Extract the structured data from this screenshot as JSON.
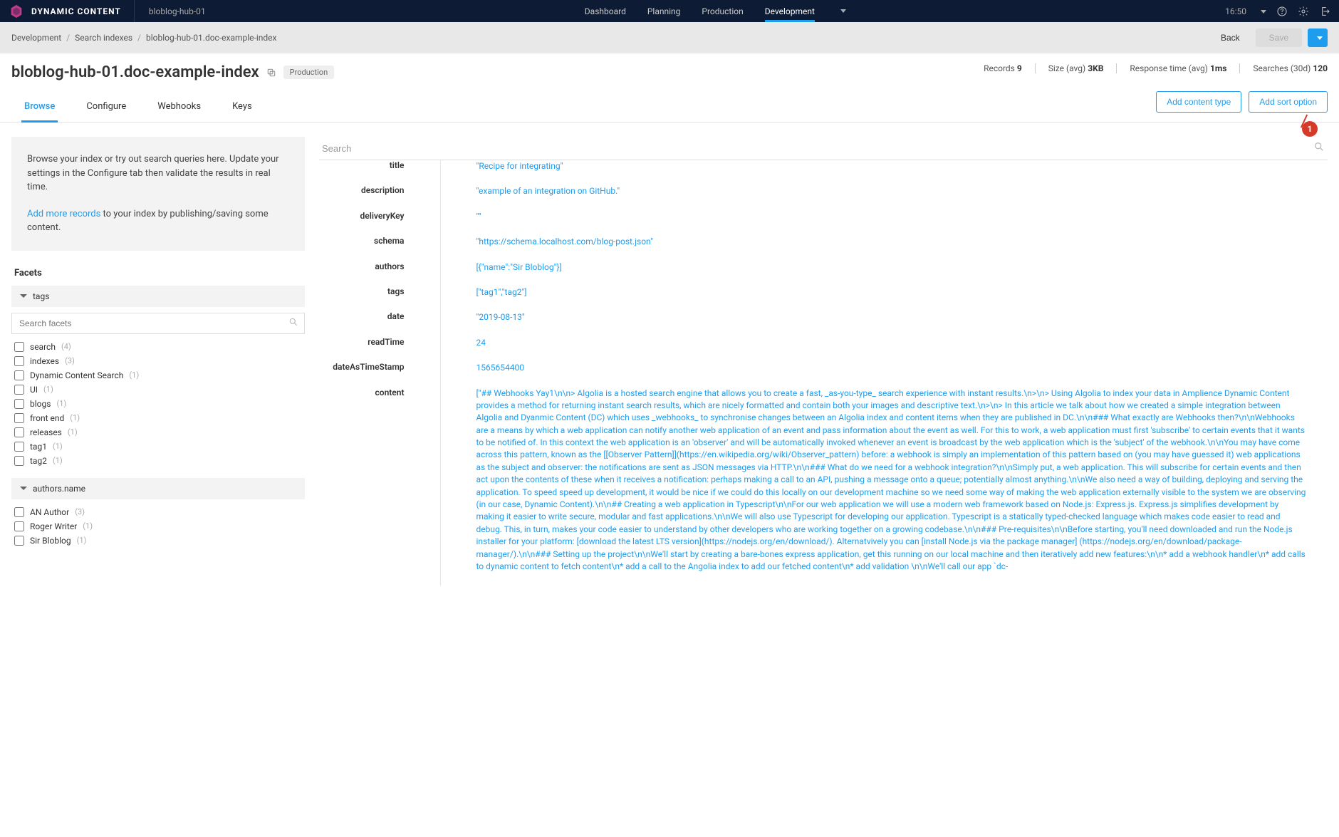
{
  "brand": "DYNAMIC CONTENT",
  "hubName": "bloblog-hub-01",
  "topnav": [
    "Dashboard",
    "Planning",
    "Production",
    "Development"
  ],
  "topnavActive": "Development",
  "clock": "16:50",
  "breadcrumb": {
    "parts": [
      "Development",
      "Search indexes",
      "bloblog-hub-01.doc-example-index"
    ],
    "backLabel": "Back",
    "saveLabel": "Save"
  },
  "page": {
    "title": "bloblog-hub-01.doc-example-index",
    "envBadge": "Production",
    "stats": [
      {
        "label": "Records",
        "value": "9"
      },
      {
        "label": "Size (avg)",
        "value": "3KB"
      },
      {
        "label": "Response time (avg)",
        "value": "1ms"
      },
      {
        "label": "Searches (30d)",
        "value": "120"
      }
    ],
    "tabs": [
      "Browse",
      "Configure",
      "Webhooks",
      "Keys"
    ],
    "activeTab": "Browse",
    "buttons": {
      "addContentType": "Add content type",
      "addSortOption": "Add sort option"
    }
  },
  "callout": "1",
  "infoBox": {
    "line1": "Browse your index or try out search queries here. Update your settings in the Configure tab then validate the results in real time.",
    "linkText": "Add more records",
    "line2tail": " to your index by publishing/saving some content."
  },
  "facets": {
    "title": "Facets",
    "searchPlaceholder": "Search facets",
    "groups": [
      {
        "name": "tags",
        "items": [
          {
            "label": "search",
            "count": "(4)"
          },
          {
            "label": "indexes",
            "count": "(3)"
          },
          {
            "label": "Dynamic Content Search",
            "count": "(1)"
          },
          {
            "label": "UI",
            "count": "(1)"
          },
          {
            "label": "blogs",
            "count": "(1)"
          },
          {
            "label": "front end",
            "count": "(1)"
          },
          {
            "label": "releases",
            "count": "(1)"
          },
          {
            "label": "tag1",
            "count": "(1)"
          },
          {
            "label": "tag2",
            "count": "(1)"
          }
        ]
      },
      {
        "name": "authors.name",
        "items": [
          {
            "label": "AN Author",
            "count": "(3)"
          },
          {
            "label": "Roger Writer",
            "count": "(1)"
          },
          {
            "label": "Sir Bloblog",
            "count": "(1)"
          }
        ]
      }
    ]
  },
  "searchPlaceholder": "Search",
  "record": {
    "title": "\"Recipe for integrating\"",
    "description": "\"example of an integration on GitHub.\"",
    "deliveryKey": "\"\"",
    "schema": "\"https://schema.localhost.com/blog-post.json\"",
    "authors": "[{\"name\":\"Sir Bloblog\"}]",
    "tags": "[\"tag1\",\"tag2\"]",
    "date": "\"2019-08-13\"",
    "readTime": "24",
    "dateAsTimeStamp": "1565654400",
    "content": "[\"## Webhooks Yay1\\n\\n> Algolia is a hosted search engine that allows you to create a fast, _as-you-type_ search experience with instant results.\\n>\\n> Using Algolia to index your data in Amplience Dynamic Content provides a method for returning instant search results, which are nicely formatted and contain both your images and descriptive text.\\n>\\n> In this article we talk about how we created a simple integration between Algolia and Dyanmic Content (DC) which uses _webhooks_ to synchronise changes between an Algolia index and content items when they are published in DC.\\n\\n### What exactly are Webhooks then?\\n\\nWebhooks are a means by which a web application can notify another web application of an event and pass information about the event as well. For this to work, a web application must first 'subscribe' to certain events that it wants to be notified of. In this context the web application is an 'observer' and will be automatically invoked whenever an event is broadcast by the web application which is the 'subject' of the webhook.\\n\\nYou may have come across this pattern, known as the [[Observer Pattern]](https://en.wikipedia.org/wiki/Observer_pattern) before: a webhook is simply an implementation of this pattern based on (you may have guessed it) web applications as the subject and observer: the notifications are sent as JSON messages via HTTP.\\n\\n### What do we need for a webhook integration?\\n\\nSimply put, a web application. This will subscribe for certain events and then act upon the contents of these when it receives a notification: perhaps making a call to an API, pushing a message onto a queue; potentially almost anything.\\n\\nWe also need a way of building, deploying and serving the application. To speed speed up development, it would be nice if we could do this locally on our development machine so we need some way of making the web application externally visible to the system we are observing (in our case, Dynamic Content).\\n\\n## Creating a web application in Typescript\\n\\nFor our web application we will use a modern web framework based on Node.js: Express.js. Express.js simplifies development by making it easier to write secure, modular and fast applications.\\n\\nWe will also use Typescript for developing our application. Typescript is a statically typed-checked language which makes code easier to read and debug. This, in turn, makes your code easier to understand by other developers who are working together on a growing codebase.\\n\\n### Pre-requisites\\n\\nBefore starting, you'll need downloaded and run the Node.js installer for your platform: [download the latest LTS version](https://nodejs.org/en/download/). Alternatvively you can [install Node.js via the package manager] (https://nodejs.org/en/download/package-manager/).\\n\\n### Setting up the project\\n\\nWe'll start by creating a bare-bones express application, get this running on our local machine and then iteratively add new features:\\n\\n* add a webhook handler\\n* add calls to dynamic content to fetch content\\n* add a call to the Angolia index to add our fetched content\\n* add validation \\n\\nWe'll call our app `dc-"
  },
  "recordLabels": {
    "title": "title",
    "description": "description",
    "deliveryKey": "deliveryKey",
    "schema": "schema",
    "authors": "authors",
    "tags": "tags",
    "date": "date",
    "readTime": "readTime",
    "dateAsTimeStamp": "dateAsTimeStamp",
    "content": "content"
  }
}
